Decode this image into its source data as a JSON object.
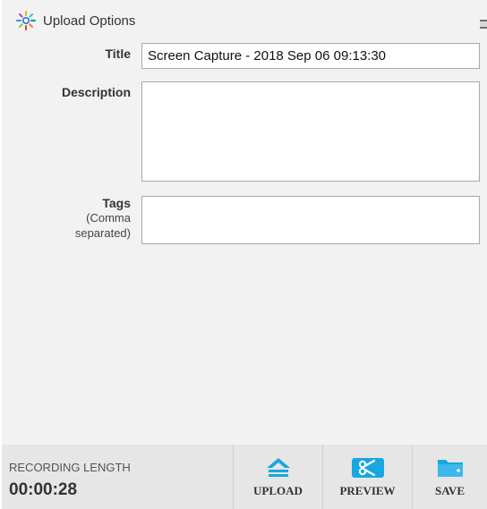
{
  "header": {
    "title": "Upload Options"
  },
  "form": {
    "title_label": "Title",
    "title_value": "Screen Capture - 2018 Sep 06 09:13:30",
    "description_label": "Description",
    "description_value": "",
    "tags_label": "Tags",
    "tags_hint_1": "(Comma",
    "tags_hint_2": "separated)",
    "tags_value": ""
  },
  "footer": {
    "recording_length_label": "RECORDING LENGTH",
    "recording_length_value": "00:00:28",
    "upload_label": "UPLOAD",
    "preview_label": "PREVIEW",
    "save_label": "SAVE"
  },
  "colors": {
    "accent": "#19a7e0",
    "panel_bg": "#f2f2f2",
    "footer_bg": "#e6e6e6"
  },
  "icons": {
    "logo": "sunburst-logo-icon",
    "upload": "upload-arrow-icon",
    "preview": "scissors-icon",
    "save": "folder-save-icon"
  }
}
